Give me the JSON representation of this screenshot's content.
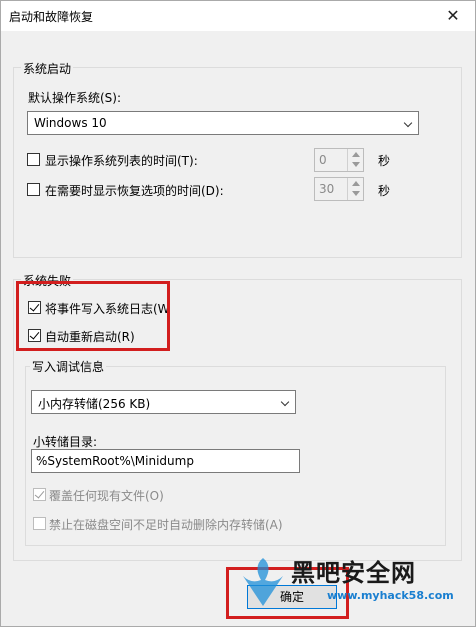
{
  "window": {
    "title": "启动和故障恢复",
    "close_glyph": "✕"
  },
  "system_startup": {
    "group_label": "系统启动",
    "default_os_label": "默认操作系统(S):",
    "default_os_value": "Windows 10",
    "show_os_list_label": "显示操作系统列表的时间(T):",
    "show_os_list_value": "0",
    "show_os_list_unit": "秒",
    "show_recovery_label": "在需要时显示恢复选项的时间(D):",
    "show_recovery_value": "30",
    "show_recovery_unit": "秒"
  },
  "system_failure": {
    "group_label": "系统失败",
    "write_event_label": "将事件写入系统日志(W",
    "auto_restart_label": "自动重新启动(R)",
    "debug_info": {
      "group_label": "写入调试信息",
      "dump_type_value": "小内存转储(256 KB)",
      "dump_dir_label": "小转储目录:",
      "dump_dir_value": "%SystemRoot%\\Minidump",
      "overwrite_label": "覆盖任何现有文件(O)",
      "disable_auto_delete_label": "禁止在磁盘空间不足时自动删除内存转储(A)"
    }
  },
  "buttons": {
    "ok_label": "确定"
  },
  "watermark": {
    "brand": "黑吧安全网",
    "url": "www.myhack58.com"
  },
  "colors": {
    "highlight_red": "#d21e1e",
    "accent_blue": "#0078d7"
  }
}
